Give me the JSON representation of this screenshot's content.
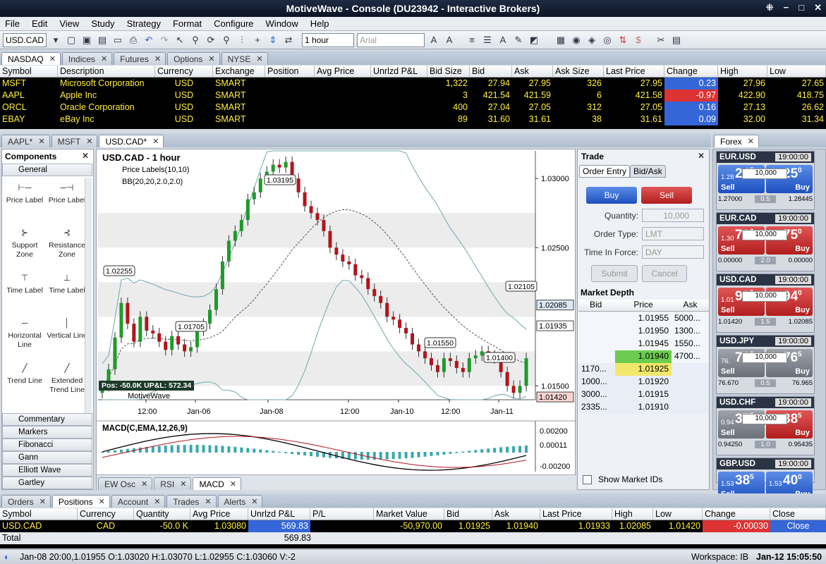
{
  "window": {
    "title": "MotiveWave - Console (DU23942 - Interactive Brokers)"
  },
  "menu": [
    "File",
    "Edit",
    "View",
    "Study",
    "Strategy",
    "Format",
    "Configure",
    "Window",
    "Help"
  ],
  "toolbar": {
    "symbol": "USD.CAD",
    "interval": "1 hour",
    "font": "Arial"
  },
  "watchlist": {
    "tabs": [
      "NASDAQ",
      "Indices",
      "Futures",
      "Options",
      "NYSE"
    ],
    "columns": [
      "Symbol",
      "Description",
      "Currency",
      "Exchange",
      "Position",
      "Avg Price",
      "Unrlzd P&L",
      "Bid Size",
      "Bid",
      "Ask",
      "Ask Size",
      "Last Price",
      "Change",
      "High",
      "Low"
    ],
    "rows": [
      {
        "symbol": "MSFT",
        "desc": "Microsoft Corporation",
        "cur": "USD",
        "exch": "SMART",
        "bidsize": "1,322",
        "bid": "27.94",
        "ask": "27.95",
        "asksize": "326",
        "last": "27.95",
        "change": "0.23",
        "high": "27.96",
        "low": "27.65",
        "dir": "up"
      },
      {
        "symbol": "AAPL",
        "desc": "Apple Inc",
        "cur": "USD",
        "exch": "SMART",
        "bidsize": "3",
        "bid": "421.54",
        "ask": "421.59",
        "asksize": "6",
        "last": "421.58",
        "change": "-0.97",
        "high": "422.90",
        "low": "418.75",
        "dir": "dn"
      },
      {
        "symbol": "ORCL",
        "desc": "Oracle Corporation",
        "cur": "USD",
        "exch": "SMART",
        "bidsize": "400",
        "bid": "27.04",
        "ask": "27.05",
        "asksize": "312",
        "last": "27.05",
        "change": "0.16",
        "high": "27.13",
        "low": "26.62",
        "dir": "up"
      },
      {
        "symbol": "EBAY",
        "desc": "eBay Inc",
        "cur": "USD",
        "exch": "SMART",
        "bidsize": "89",
        "bid": "31.60",
        "ask": "31.61",
        "asksize": "38",
        "last": "31.61",
        "change": "0.09",
        "high": "32.00",
        "low": "31.34",
        "dir": "up"
      }
    ]
  },
  "chart_tabs": [
    "AAPL*",
    "MSFT",
    "USD.CAD*"
  ],
  "components": {
    "title": "Components",
    "general": "General",
    "items": [
      [
        "Price Label",
        "Price Label"
      ],
      [
        "Support Zone",
        "Resistance Zone"
      ],
      [
        "Time Label",
        "Time Label"
      ],
      [
        "Horizontal Line",
        "Vertical Line"
      ],
      [
        "Trend Line",
        "Extended Trend Line"
      ]
    ],
    "categories": [
      "Commentary",
      "Markers",
      "Fibonacci",
      "Gann",
      "Elliott Wave",
      "Gartley"
    ]
  },
  "chart": {
    "title": "USD.CAD - 1 hour",
    "legend1": "Price Labels(10,10)",
    "legend2": "BB(20,20,2.0,2.0)",
    "position": "Pos: -50.0K UP&L: 572.34",
    "brand": "MotiveWave",
    "yticks": [
      "1.03000",
      "1.02500",
      "1.01500"
    ],
    "price_labels": [
      "1.03195",
      "1.02255",
      "1.01705",
      "1.01550",
      "1.01400",
      "1.02105"
    ],
    "right_labels": {
      "upper": "1.02085",
      "mid": "1.01935",
      "last": "1.01420"
    },
    "xticks": [
      "12:00",
      "Jan-06",
      "Jan-08",
      "12:00",
      "Jan-10",
      "12:00",
      "Jan-11"
    ],
    "macd_title": "MACD(C,EMA,12,26,9)",
    "macd_ticks": [
      "0.00200",
      "0.00011",
      "-0.00200"
    ],
    "study_tabs": [
      "EW Osc",
      "RSI",
      "MACD"
    ]
  },
  "trade": {
    "title": "Trade",
    "tabs": [
      "Order Entry",
      "Bid/Ask"
    ],
    "buy": "Buy",
    "sell": "Sell",
    "quantity_label": "Quantity:",
    "quantity": "10,000",
    "ordertype_label": "Order Type:",
    "ordertype": "LMT",
    "tif_label": "Time In Force:",
    "tif": "DAY",
    "submit": "Submit",
    "cancel": "Cancel",
    "depth_title": "Market Depth",
    "depth_cols": [
      "Bid",
      "Price",
      "Ask"
    ],
    "depth": [
      {
        "bid": "",
        "price": "1.01955",
        "ask": "5000..."
      },
      {
        "bid": "",
        "price": "1.01950",
        "ask": "1300..."
      },
      {
        "bid": "",
        "price": "1.01945",
        "ask": "1550..."
      },
      {
        "bid": "",
        "price": "1.01940",
        "ask": "4700..."
      },
      {
        "bid": "1170...",
        "price": "1.01925",
        "ask": ""
      },
      {
        "bid": "1000...",
        "price": "1.01920",
        "ask": ""
      },
      {
        "bid": "3000...",
        "price": "1.01915",
        "ask": ""
      },
      {
        "bid": "2335...",
        "price": "1.01910",
        "ask": ""
      }
    ],
    "show_ids": "Show Market IDs"
  },
  "forex": {
    "tab": "Forex",
    "pairs": [
      {
        "name": "EUR.USD",
        "time": "19:00:00",
        "sell_pre": "1.28",
        "sell_big": "24",
        "sell_sup": "5",
        "buy_pre": "1.28",
        "buy_big": "25",
        "buy_sup": "0",
        "qty": "10,000",
        "low": "1.27000",
        "spread": "0.5",
        "high": "1.28445",
        "scolor": "blue",
        "bcolor": "blue"
      },
      {
        "name": "EUR.CAD",
        "time": "19:00:00",
        "sell_pre": "1.30",
        "sell_big": "73",
        "sell_sup": "0",
        "buy_pre": "1.30",
        "buy_big": "75",
        "buy_sup": "0",
        "qty": "10,000",
        "low": "0.00000",
        "spread": "2.0",
        "high": "0.00000",
        "scolor": "red",
        "bcolor": "red"
      },
      {
        "name": "USD.CAD",
        "time": "19:00:00",
        "sell_pre": "1.01",
        "sell_big": "92",
        "sell_sup": "5",
        "buy_pre": "1.01",
        "buy_big": "94",
        "buy_sup": "0",
        "qty": "10,000",
        "low": "1.01420",
        "spread": "1.5",
        "high": "1.02085",
        "scolor": "red",
        "bcolor": "red"
      },
      {
        "name": "USD.JPY",
        "time": "19:00:00",
        "sell_pre": "76.",
        "sell_big": "76",
        "sell_sup": "0",
        "buy_pre": "76.",
        "buy_big": "76",
        "buy_sup": "5",
        "qty": "10,000",
        "low": "76.670",
        "spread": "0.5",
        "high": "76.965",
        "scolor": "grey",
        "bcolor": "grey"
      },
      {
        "name": "USD.CHF",
        "time": "19:00:00",
        "sell_pre": "0.94",
        "sell_big": "37",
        "sell_sup": "5",
        "buy_pre": "0.94",
        "buy_big": "38",
        "buy_sup": "5",
        "qty": "10,000",
        "low": "0.94250",
        "spread": "1.0",
        "high": "0.95435",
        "scolor": "grey",
        "bcolor": "red"
      },
      {
        "name": "GBP.USD",
        "time": "19:00:00",
        "sell_pre": "1.53",
        "sell_big": "38",
        "sell_sup": "5",
        "buy_pre": "1.53",
        "buy_big": "40",
        "buy_sup": "0",
        "qty": "10,000",
        "low": "",
        "spread": "",
        "high": "",
        "scolor": "blue",
        "bcolor": "blue"
      }
    ]
  },
  "orders": {
    "tabs": [
      "Orders",
      "Positions",
      "Account",
      "Trades",
      "Alerts"
    ],
    "columns": [
      "Symbol",
      "Currency",
      "Quantity",
      "Avg Price",
      "Unrlzd P&L",
      "P/L",
      "Market Value",
      "Bid",
      "Ask",
      "Last Price",
      "High",
      "Low",
      "Change",
      "Close"
    ],
    "row": {
      "symbol": "USD.CAD",
      "cur": "CAD",
      "qty": "-50.0 K",
      "avg": "1.03080",
      "upl": "569.83",
      "pl": "",
      "mv": "-50,970.00",
      "bid": "1.01925",
      "ask": "1.01940",
      "last": "1.01933",
      "high": "1.02085",
      "low": "1.01420",
      "change": "-0.00030",
      "close": "Close"
    },
    "total_label": "Total",
    "total": "569.83"
  },
  "status": {
    "bar": "Jan-08 20:00,1.01955 O:1.03020 H:1.03070 L:1.02955 C:1.03060 V:-2",
    "workspace": "Workspace: IB",
    "clock": "Jan-12 15:05:50"
  },
  "colors": {
    "up": "#3566d8",
    "down": "#d33333",
    "highlight": "#ffef3a"
  },
  "chart_data": {
    "type": "candlestick",
    "title": "USD.CAD - 1 hour",
    "closes": [
      1.015,
      1.0162,
      1.0185,
      1.021,
      1.0195,
      1.0182,
      1.02,
      1.019,
      1.0188,
      1.0182,
      1.0176,
      1.0186,
      1.018,
      1.0175,
      1.0178,
      1.019,
      1.0195,
      1.0205,
      1.022,
      1.024,
      1.0255,
      1.0262,
      1.027,
      1.0285,
      1.029,
      1.03,
      1.0305,
      1.031,
      1.0308,
      1.0312,
      1.03,
      1.029,
      1.028,
      1.0275,
      1.027,
      1.0262,
      1.025,
      1.0245,
      1.024,
      1.0238,
      1.023,
      1.0228,
      1.022,
      1.0215,
      1.021,
      1.02,
      1.0198,
      1.0192,
      1.0188,
      1.018,
      1.0175,
      1.017,
      1.0165,
      1.016,
      1.017,
      1.0168,
      1.0163,
      1.016,
      1.017,
      1.0172,
      1.0175,
      1.0172,
      1.017,
      1.016,
      1.015,
      1.0145,
      1.015,
      1.017
    ],
    "ylim": [
      1.014,
      1.032
    ]
  }
}
